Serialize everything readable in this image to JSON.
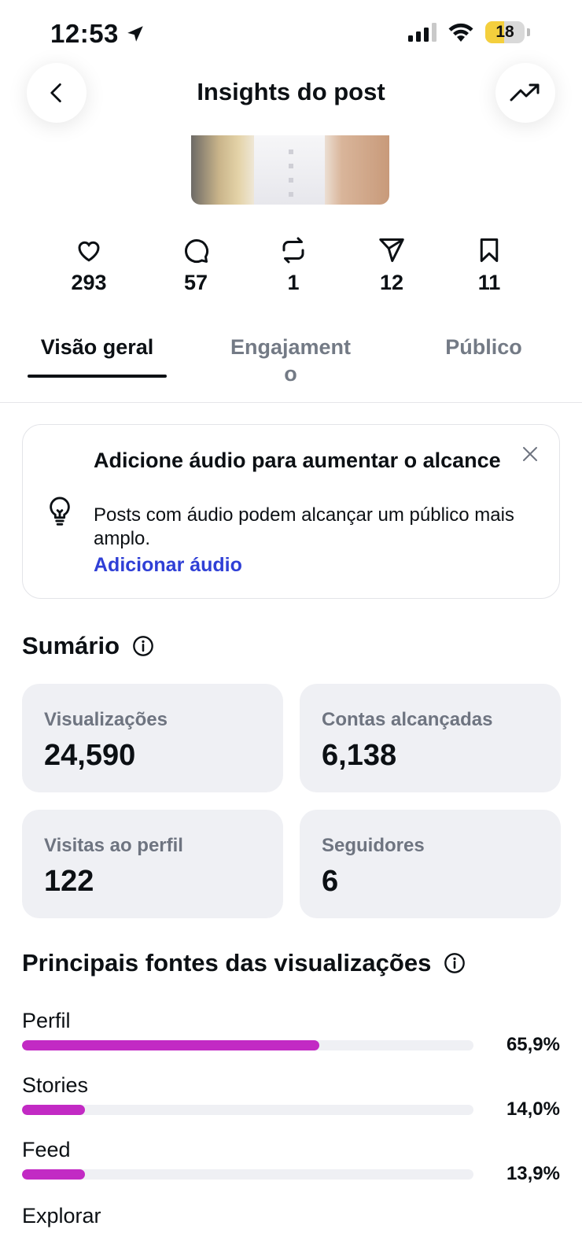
{
  "status_bar": {
    "time": "12:53",
    "battery": "18",
    "battery_level": 0.18
  },
  "header": {
    "title": "Insights do post"
  },
  "metrics": [
    {
      "icon": "heart-icon",
      "value": "293"
    },
    {
      "icon": "comment-icon",
      "value": "57"
    },
    {
      "icon": "repost-icon",
      "value": "1"
    },
    {
      "icon": "send-icon",
      "value": "12"
    },
    {
      "icon": "bookmark-icon",
      "value": "11"
    }
  ],
  "tabs": [
    "Visão geral",
    "Engajament o",
    "Público"
  ],
  "audio_card": {
    "title": "Adicione áudio para aumentar o alcance",
    "body": "Posts com áudio podem alcançar um público mais amplo.",
    "link": "Adicionar áudio"
  },
  "summary": {
    "title": "Sumário",
    "stats": [
      {
        "label": "Visualizações",
        "value": "24,590"
      },
      {
        "label": "Contas alcançadas",
        "value": "6,138"
      },
      {
        "label": "Visitas ao perfil",
        "value": "122"
      },
      {
        "label": "Seguidores",
        "value": "6"
      }
    ]
  },
  "sources": {
    "title": "Principais fontes das visualizações",
    "items": [
      {
        "name": "Perfil",
        "percent_label": "65,9%",
        "percent": 65.9
      },
      {
        "name": "Stories",
        "percent_label": "14,0%",
        "percent": 14.0
      },
      {
        "name": "Feed",
        "percent_label": "13,9%",
        "percent": 13.9
      },
      {
        "name": "Explorar"
      }
    ]
  },
  "colors": {
    "accent_link": "#2f3fd6",
    "bar": "#c22ac4",
    "card_bg": "#eff0f4"
  }
}
